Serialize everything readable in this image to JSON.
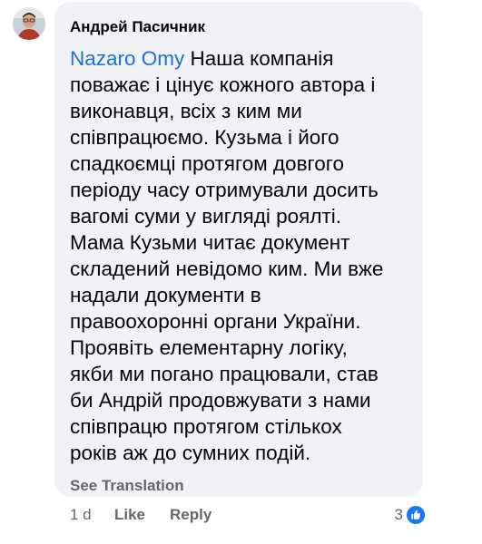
{
  "comment": {
    "author": "Андрей Пасичник",
    "mention": "Nazaro Omy",
    "text_lines": [
      " Наша компанія",
      "поважає і цінує кожного автора і",
      "виконавця, всіх з ким ми",
      "співпрацюємо. Кузьма і його",
      "спадкоємці протягом довгого",
      "періоду часу отримували досить",
      "вагомі суми у вигляді роялті.",
      "Мама Кузьми читає документ",
      "складений невідомо ким. Ми вже",
      "надали документи в",
      "правоохоронні органи України.",
      "Проявіть елементарну логіку,",
      "якби ми погано працювали, став",
      "би Андрій продовжувати з нами",
      "співпрацю протягом стількох",
      "років аж до сумних подій."
    ],
    "see_translation": "See Translation"
  },
  "actions": {
    "time": "1 d",
    "like_label": "Like",
    "reply_label": "Reply",
    "reaction_count": "3",
    "reaction_icon": "thumbs-up-icon"
  },
  "colors": {
    "bubble_bg": "#f0f2f5",
    "mention": "#216fdb",
    "secondary_text": "#65676b",
    "like_blue": "#1877f2"
  }
}
